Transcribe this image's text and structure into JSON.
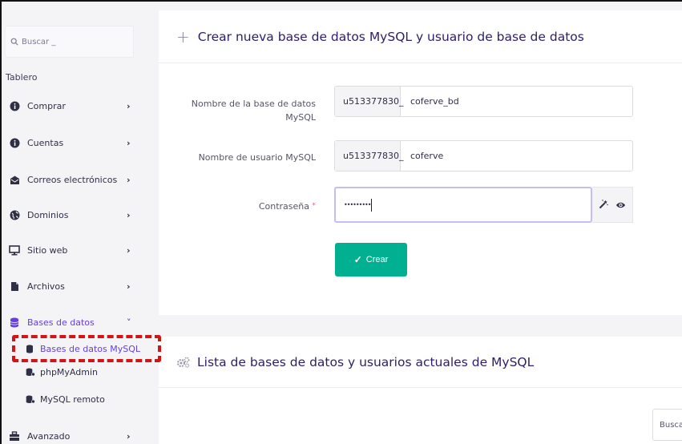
{
  "sidebar": {
    "search_placeholder": "Buscar _",
    "section_label": "Tablero",
    "items": [
      {
        "label": "Comprar",
        "chevron": "›"
      },
      {
        "label": "Cuentas",
        "chevron": "›"
      },
      {
        "label": "Correos electrónicos",
        "chevron": "›"
      },
      {
        "label": "Dominios",
        "chevron": "›"
      },
      {
        "label": "Sitio web",
        "chevron": "›"
      },
      {
        "label": "Archivos",
        "chevron": "›"
      },
      {
        "label": "Bases de datos",
        "chevron": "˅"
      },
      {
        "label": "Avanzado",
        "chevron": "›"
      }
    ],
    "sub_items": [
      {
        "label": "Bases de datos MySQL"
      },
      {
        "label": "phpMyAdmin"
      },
      {
        "label": "MySQL remoto"
      }
    ]
  },
  "create_card": {
    "title": "Crear nueva base de datos MySQL y usuario de base de datos",
    "db_name_label": "Nombre de la base de datos MySQL",
    "db_prefix": "u513377830_",
    "db_name_value": "coferve_bd",
    "user_label": "Nombre de usuario MySQL",
    "user_prefix": "u513377830_",
    "user_value": "coferve",
    "password_label": "Contraseña",
    "password_required": "*",
    "password_value": "•••••••••",
    "create_button": "Crear"
  },
  "list_card": {
    "title": "Lista de bases de datos y usuarios actuales de MySQL",
    "search_placeholder": "Busca"
  },
  "colors": {
    "accent": "#673de6",
    "create_button": "#00b090",
    "highlight": "#d11414",
    "title": "#2f1c6a"
  },
  "icons": {
    "search": "search-icon",
    "info": "info-icon",
    "mail": "mail-icon",
    "globe": "globe-icon",
    "monitor": "monitor-icon",
    "file": "file-icon",
    "database": "database-icon",
    "toolbox": "toolbox-icon",
    "plus": "plus-icon",
    "magic_wand": "magic-wand-icon",
    "eye": "eye-icon",
    "check": "check-icon",
    "gears": "gears-icon"
  }
}
